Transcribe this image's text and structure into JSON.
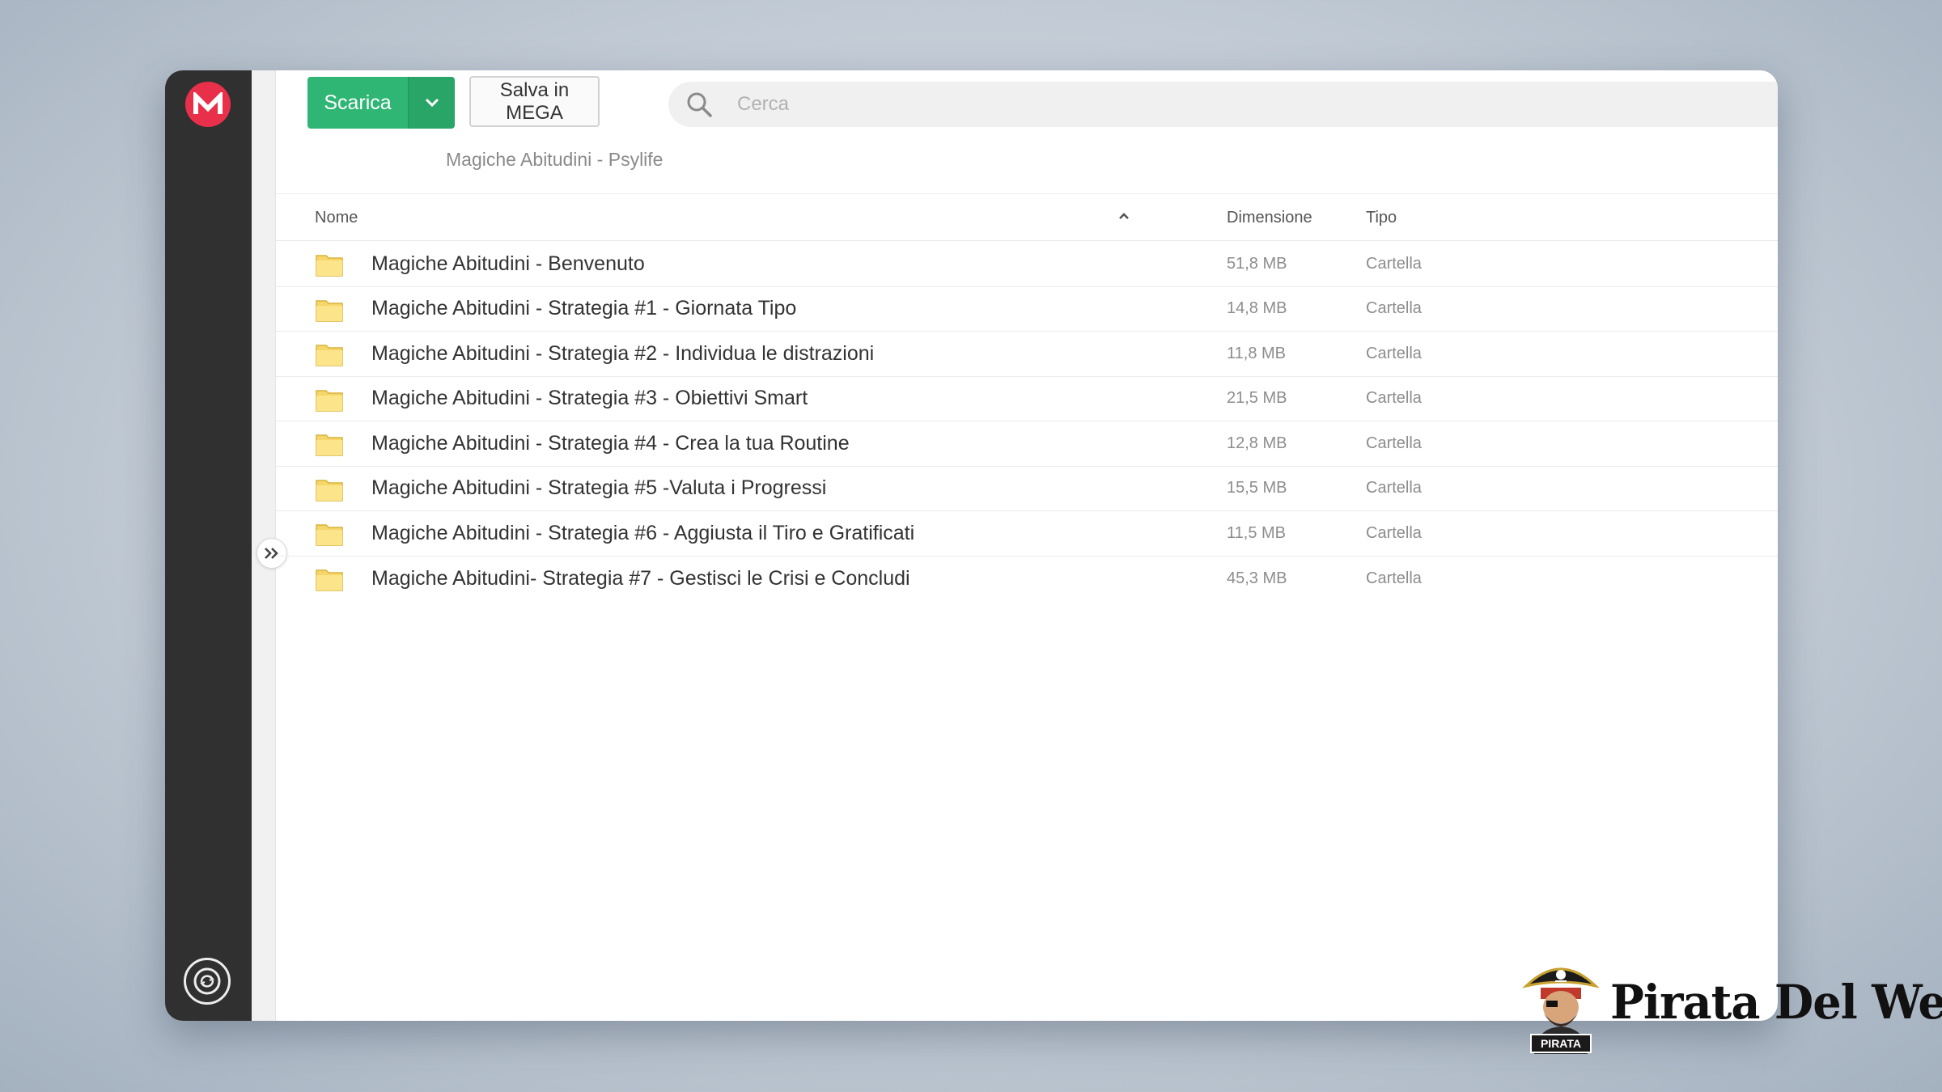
{
  "toolbar": {
    "download_label": "Scarica",
    "save_label": "Salva in MEGA"
  },
  "search": {
    "placeholder": "Cerca"
  },
  "breadcrumb": {
    "current_folder": "Magiche Abitudini - Psylife"
  },
  "table": {
    "columns": {
      "name": "Nome",
      "size": "Dimensione",
      "type": "Tipo"
    },
    "rows": [
      {
        "name": "Magiche Abitudini - Benvenuto",
        "size": "51,8 MB",
        "type": "Cartella"
      },
      {
        "name": "Magiche Abitudini - Strategia #1 - Giornata Tipo",
        "size": "14,8 MB",
        "type": "Cartella"
      },
      {
        "name": "Magiche Abitudini - Strategia #2 - Individua le distrazioni",
        "size": "11,8 MB",
        "type": "Cartella"
      },
      {
        "name": "Magiche Abitudini - Strategia #3 - Obiettivi Smart",
        "size": "21,5 MB",
        "type": "Cartella"
      },
      {
        "name": "Magiche Abitudini - Strategia #4 - Crea la tua Routine",
        "size": "12,8 MB",
        "type": "Cartella"
      },
      {
        "name": "Magiche Abitudini - Strategia #5 -Valuta i Progressi",
        "size": "15,5 MB",
        "type": "Cartella"
      },
      {
        "name": "Magiche Abitudini - Strategia #6 - Aggiusta il Tiro e Gratificati",
        "size": "11,5 MB",
        "type": "Cartella"
      },
      {
        "name": "Magiche Abitudini- Strategia #7 - Gestisci le Crisi e Concludi",
        "size": "45,3 MB",
        "type": "Cartella"
      }
    ]
  },
  "watermark": {
    "brand_text": "Pirata Del Web",
    "badge_text": "PIRATA"
  },
  "icons": {
    "logo": "mega-logo-icon",
    "sync": "sync-icon",
    "expand": "double-chevron-right-icon",
    "search": "search-icon",
    "folder": "folder-icon",
    "sort": "chevron-up-icon",
    "dropdown": "chevron-down-icon"
  },
  "colors": {
    "brand_red": "#e8304a",
    "download_green": "#2fb574",
    "sidebar_dark": "#303030",
    "folder_yellow": "#f6d66a"
  }
}
